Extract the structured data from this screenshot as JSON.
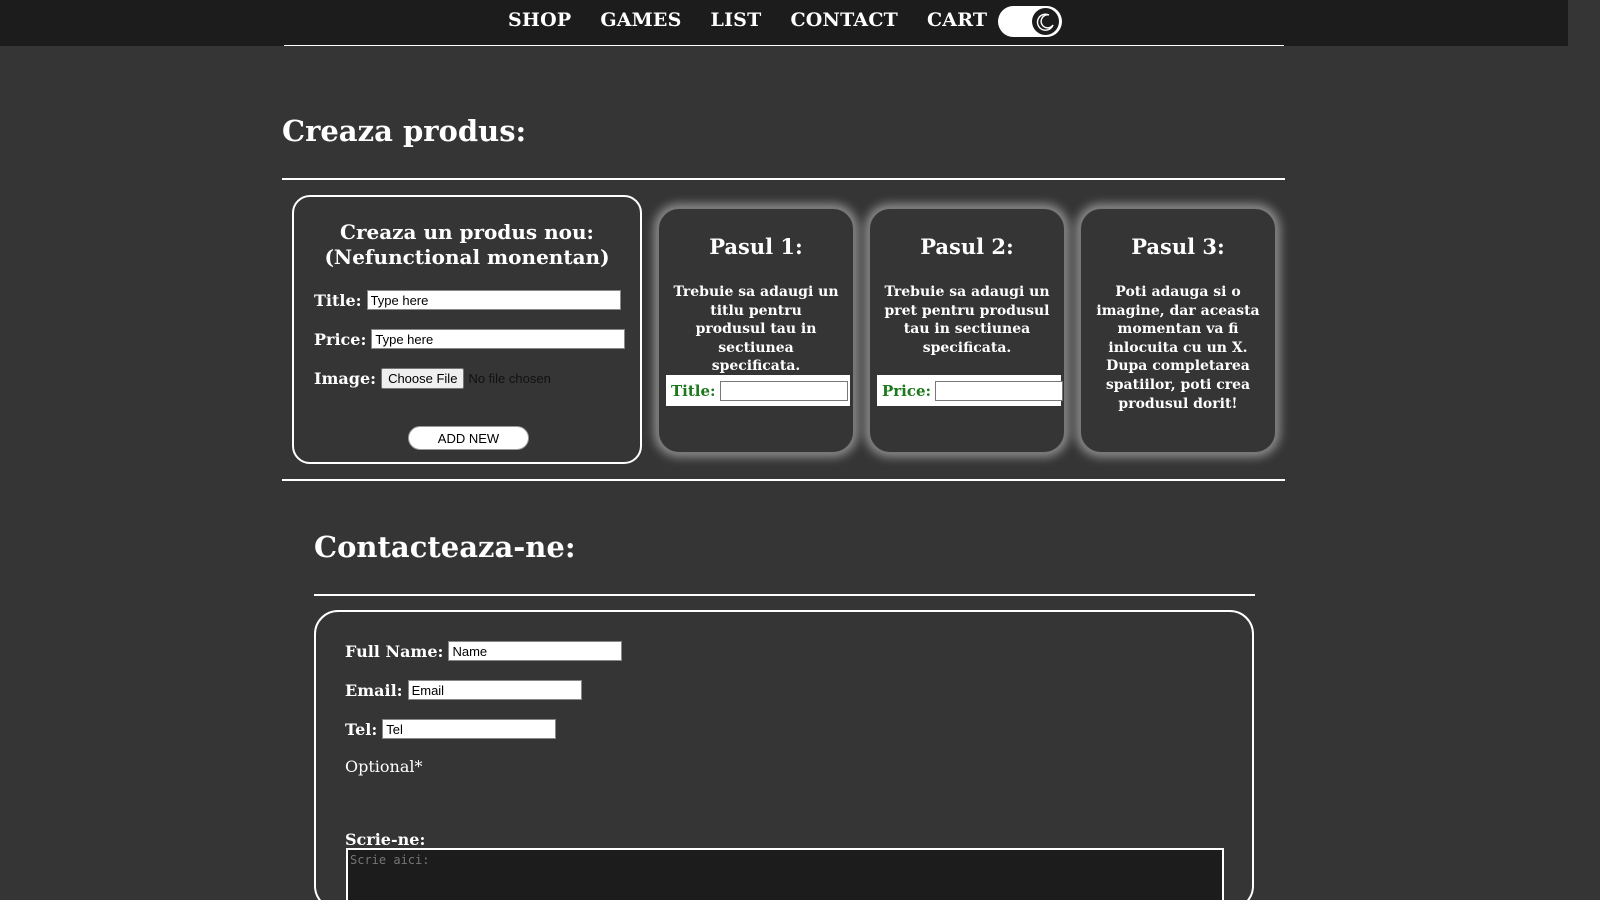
{
  "nav": {
    "items": [
      "SHOP",
      "GAMES",
      "LIST",
      "CONTACT",
      "CART"
    ],
    "theme_toggle_icon": "moon-icon"
  },
  "create_section": {
    "title": "Creaza produs:",
    "form": {
      "heading_line1": "Creaza un produs nou:",
      "heading_line2": "(Nefunctional monentan)",
      "title_label": "Title:",
      "title_value": "Type here",
      "price_label": "Price:",
      "price_value": "Type here",
      "image_label": "Image:",
      "file_button": "Choose File",
      "file_status": "No file chosen",
      "add_button": "ADD NEW"
    },
    "steps": [
      {
        "title": "Pasul 1:",
        "text": "Trebuie sa adaugi un titlu pentru produsul tau in sectiunea specificata.",
        "field_label": "Title:"
      },
      {
        "title": "Pasul 2:",
        "text": "Trebuie sa adaugi un pret pentru produsul tau in sectiunea specificata.",
        "field_label": "Price:"
      },
      {
        "title": "Pasul 3:",
        "text": "Poti adauga si o imagine, dar aceasta momentan va fi inlocuita cu un X. Dupa completarea spatiilor, poti crea produsul dorit!"
      }
    ]
  },
  "contact_section": {
    "title": "Contacteaza-ne:",
    "fullname_label": "Full Name:",
    "fullname_value": "Name",
    "email_label": "Email:",
    "email_value": "Email",
    "tel_label": "Tel:",
    "tel_value": "Tel",
    "optional_note": "Optional*",
    "message_label": "Scrie-ne:",
    "message_placeholder": "Scrie aici:"
  },
  "colors": {
    "background": "#353535",
    "topbar": "#1c1c1c",
    "accent_green": "#1c7a1c"
  }
}
